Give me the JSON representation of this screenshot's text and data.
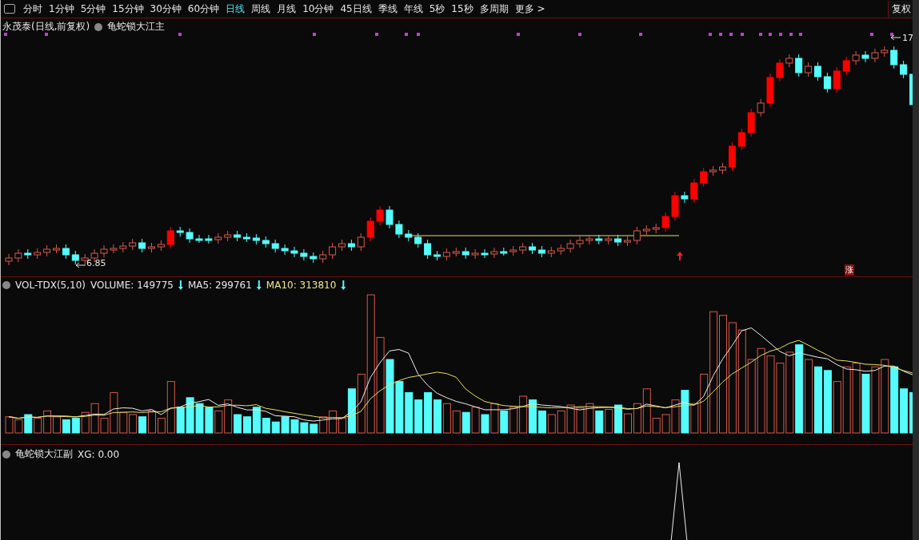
{
  "toolbar": {
    "periods": [
      {
        "label": "分时",
        "selected": false
      },
      {
        "label": "1分钟",
        "selected": false
      },
      {
        "label": "5分钟",
        "selected": false
      },
      {
        "label": "15分钟",
        "selected": false
      },
      {
        "label": "30分钟",
        "selected": false
      },
      {
        "label": "60分钟",
        "selected": false
      },
      {
        "label": "日线",
        "selected": true
      },
      {
        "label": "周线",
        "selected": false
      },
      {
        "label": "月线",
        "selected": false
      },
      {
        "label": "10分钟",
        "selected": false
      },
      {
        "label": "45日线",
        "selected": false
      },
      {
        "label": "季线",
        "selected": false
      },
      {
        "label": "年线",
        "selected": false
      },
      {
        "label": "5秒",
        "selected": false
      },
      {
        "label": "15秒",
        "selected": false
      },
      {
        "label": "多周期",
        "selected": false
      },
      {
        "label": "更多 >",
        "selected": false
      }
    ],
    "right_button": "复权"
  },
  "main_chart": {
    "stock_title": "永茂泰(日线,前复权)",
    "indicator": "龟蛇锁大江主",
    "low_label": "6.85",
    "high_label": "17",
    "badge": "涨"
  },
  "volume_panel": {
    "name": "VOL-TDX(5,10)",
    "volume": "VOLUME: 149775",
    "ma5": "MA5: 299761",
    "ma10": "MA10: 313810"
  },
  "signal_panel": {
    "name": "龟蛇锁大江副",
    "value": "XG: 0.00"
  }
}
